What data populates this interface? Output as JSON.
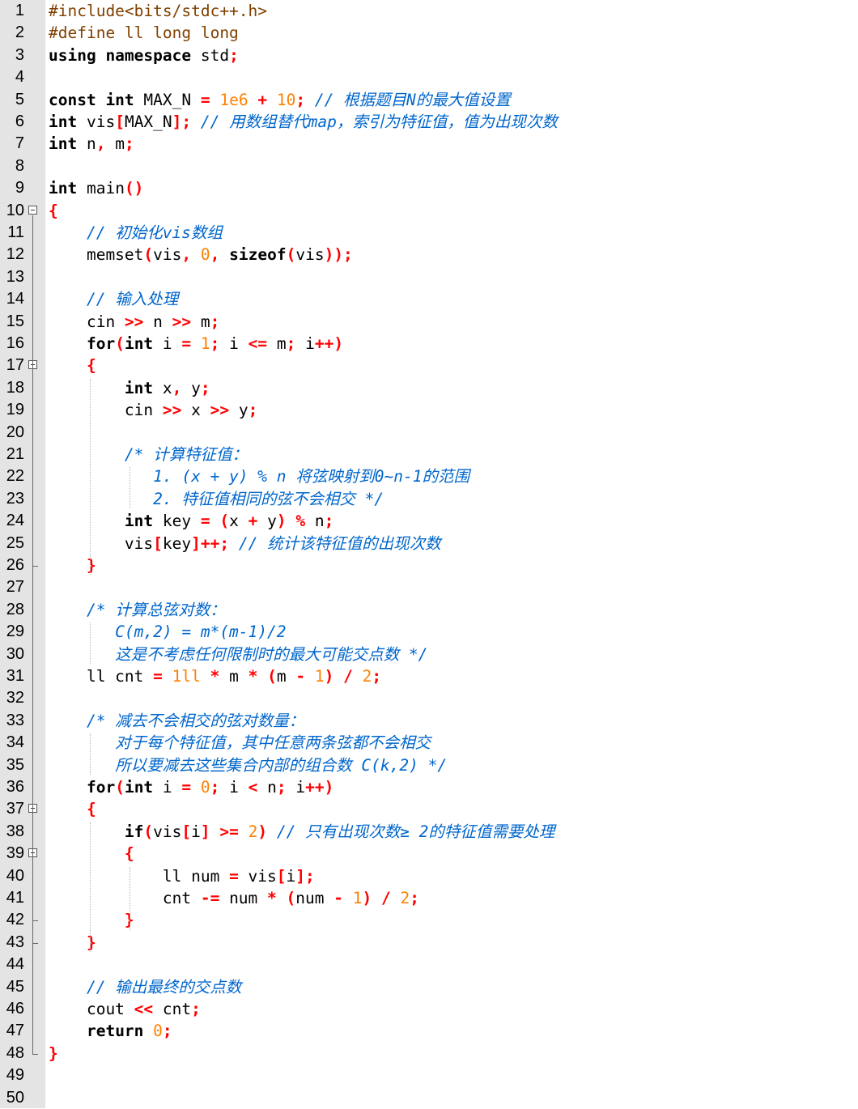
{
  "editor": {
    "language": "C++",
    "colors": {
      "gutter": "#e4e4e4",
      "keyword": "#000000",
      "number": "#ff8000",
      "operator": "#ff0000",
      "preprocessor": "#804000",
      "comment": "#0066cc"
    },
    "lines": [
      {
        "n": "1",
        "tokens": [
          [
            "pp",
            "#include<bits/stdc++.h>"
          ]
        ]
      },
      {
        "n": "2",
        "tokens": [
          [
            "pp",
            "#define ll long long"
          ]
        ]
      },
      {
        "n": "3",
        "tokens": [
          [
            "kw",
            "using namespace"
          ],
          [
            "t",
            " std"
          ],
          [
            "op",
            ";"
          ]
        ]
      },
      {
        "n": "4",
        "tokens": []
      },
      {
        "n": "5",
        "tokens": [
          [
            "kw",
            "const int"
          ],
          [
            "t",
            " MAX_N "
          ],
          [
            "op",
            "="
          ],
          [
            "t",
            " "
          ],
          [
            "num",
            "1e6"
          ],
          [
            "t",
            " "
          ],
          [
            "op",
            "+"
          ],
          [
            "t",
            " "
          ],
          [
            "num",
            "10"
          ],
          [
            "op",
            ";"
          ],
          [
            "t",
            " "
          ],
          [
            "cm",
            "// 根据题目N的最大值设置"
          ]
        ]
      },
      {
        "n": "6",
        "tokens": [
          [
            "kw",
            "int"
          ],
          [
            "t",
            " vis"
          ],
          [
            "op",
            "["
          ],
          [
            "t",
            "MAX_N"
          ],
          [
            "op",
            "];"
          ],
          [
            "t",
            " "
          ],
          [
            "cm",
            "// 用数组替代map，索引为特征值，值为出现次数"
          ]
        ]
      },
      {
        "n": "7",
        "tokens": [
          [
            "kw",
            "int"
          ],
          [
            "t",
            " n"
          ],
          [
            "op",
            ","
          ],
          [
            "t",
            " m"
          ],
          [
            "op",
            ";"
          ]
        ]
      },
      {
        "n": "8",
        "tokens": []
      },
      {
        "n": "9",
        "tokens": [
          [
            "kw",
            "int"
          ],
          [
            "t",
            " main"
          ],
          [
            "op",
            "()"
          ]
        ]
      },
      {
        "n": "10",
        "fold": true,
        "tokens": [
          [
            "op",
            "{"
          ]
        ]
      },
      {
        "n": "11",
        "tokens": [
          [
            "t",
            "    "
          ],
          [
            "cm",
            "// 初始化vis数组"
          ]
        ]
      },
      {
        "n": "12",
        "tokens": [
          [
            "t",
            "    memset"
          ],
          [
            "op",
            "("
          ],
          [
            "t",
            "vis"
          ],
          [
            "op",
            ","
          ],
          [
            "t",
            " "
          ],
          [
            "num",
            "0"
          ],
          [
            "op",
            ","
          ],
          [
            "t",
            " "
          ],
          [
            "kw",
            "sizeof"
          ],
          [
            "op",
            "("
          ],
          [
            "t",
            "vis"
          ],
          [
            "op",
            "));"
          ]
        ]
      },
      {
        "n": "13",
        "tokens": []
      },
      {
        "n": "14",
        "tokens": [
          [
            "t",
            "    "
          ],
          [
            "cm",
            "// 输入处理"
          ]
        ]
      },
      {
        "n": "15",
        "tokens": [
          [
            "t",
            "    cin "
          ],
          [
            "op",
            ">>"
          ],
          [
            "t",
            " n "
          ],
          [
            "op",
            ">>"
          ],
          [
            "t",
            " m"
          ],
          [
            "op",
            ";"
          ]
        ]
      },
      {
        "n": "16",
        "tokens": [
          [
            "t",
            "    "
          ],
          [
            "kw",
            "for"
          ],
          [
            "op",
            "("
          ],
          [
            "kw",
            "int"
          ],
          [
            "t",
            " i "
          ],
          [
            "op",
            "="
          ],
          [
            "t",
            " "
          ],
          [
            "num",
            "1"
          ],
          [
            "op",
            ";"
          ],
          [
            "t",
            " i "
          ],
          [
            "op",
            "<="
          ],
          [
            "t",
            " m"
          ],
          [
            "op",
            ";"
          ],
          [
            "t",
            " i"
          ],
          [
            "op",
            "++)"
          ]
        ]
      },
      {
        "n": "17",
        "fold": true,
        "tokens": [
          [
            "t",
            "    "
          ],
          [
            "op",
            "{"
          ]
        ]
      },
      {
        "n": "18",
        "tokens": [
          [
            "t",
            "        "
          ],
          [
            "kw",
            "int"
          ],
          [
            "t",
            " x"
          ],
          [
            "op",
            ","
          ],
          [
            "t",
            " y"
          ],
          [
            "op",
            ";"
          ]
        ]
      },
      {
        "n": "19",
        "tokens": [
          [
            "t",
            "        cin "
          ],
          [
            "op",
            ">>"
          ],
          [
            "t",
            " x "
          ],
          [
            "op",
            ">>"
          ],
          [
            "t",
            " y"
          ],
          [
            "op",
            ";"
          ]
        ]
      },
      {
        "n": "20",
        "tokens": []
      },
      {
        "n": "21",
        "tokens": [
          [
            "t",
            "        "
          ],
          [
            "cm",
            "/* 计算特征值："
          ]
        ]
      },
      {
        "n": "22",
        "tokens": [
          [
            "cm",
            "           1. (x + y) % n 将弦映射到0~n-1的范围"
          ]
        ]
      },
      {
        "n": "23",
        "tokens": [
          [
            "cm",
            "           2. 特征值相同的弦不会相交 */"
          ]
        ]
      },
      {
        "n": "24",
        "tokens": [
          [
            "t",
            "        "
          ],
          [
            "kw",
            "int"
          ],
          [
            "t",
            " key "
          ],
          [
            "op",
            "="
          ],
          [
            "t",
            " "
          ],
          [
            "op",
            "("
          ],
          [
            "t",
            "x "
          ],
          [
            "op",
            "+"
          ],
          [
            "t",
            " y"
          ],
          [
            "op",
            ")"
          ],
          [
            "t",
            " "
          ],
          [
            "op",
            "%"
          ],
          [
            "t",
            " n"
          ],
          [
            "op",
            ";"
          ]
        ]
      },
      {
        "n": "25",
        "tokens": [
          [
            "t",
            "        vis"
          ],
          [
            "op",
            "["
          ],
          [
            "t",
            "key"
          ],
          [
            "op",
            "]++;"
          ],
          [
            "t",
            " "
          ],
          [
            "cm",
            "// 统计该特征值的出现次数"
          ]
        ]
      },
      {
        "n": "26",
        "foldEnd": true,
        "tokens": [
          [
            "t",
            "    "
          ],
          [
            "op",
            "}"
          ]
        ]
      },
      {
        "n": "27",
        "tokens": []
      },
      {
        "n": "28",
        "tokens": [
          [
            "t",
            "    "
          ],
          [
            "cm",
            "/* 计算总弦对数："
          ]
        ]
      },
      {
        "n": "29",
        "tokens": [
          [
            "cm",
            "       C(m,2) = m*(m-1)/2"
          ]
        ]
      },
      {
        "n": "30",
        "tokens": [
          [
            "cm",
            "       这是不考虑任何限制时的最大可能交点数 */"
          ]
        ]
      },
      {
        "n": "31",
        "tokens": [
          [
            "t",
            "    ll cnt "
          ],
          [
            "op",
            "="
          ],
          [
            "t",
            " "
          ],
          [
            "num",
            "1ll"
          ],
          [
            "t",
            " "
          ],
          [
            "op",
            "*"
          ],
          [
            "t",
            " m "
          ],
          [
            "op",
            "*"
          ],
          [
            "t",
            " "
          ],
          [
            "op",
            "("
          ],
          [
            "t",
            "m "
          ],
          [
            "op",
            "-"
          ],
          [
            "t",
            " "
          ],
          [
            "num",
            "1"
          ],
          [
            "op",
            ")"
          ],
          [
            "t",
            " "
          ],
          [
            "op",
            "/"
          ],
          [
            "t",
            " "
          ],
          [
            "num",
            "2"
          ],
          [
            "op",
            ";"
          ]
        ]
      },
      {
        "n": "32",
        "tokens": []
      },
      {
        "n": "33",
        "tokens": [
          [
            "t",
            "    "
          ],
          [
            "cm",
            "/* 减去不会相交的弦对数量："
          ]
        ]
      },
      {
        "n": "34",
        "tokens": [
          [
            "cm",
            "       对于每个特征值，其中任意两条弦都不会相交"
          ]
        ]
      },
      {
        "n": "35",
        "tokens": [
          [
            "cm",
            "       所以要减去这些集合内部的组合数 C(k,2) */"
          ]
        ]
      },
      {
        "n": "36",
        "tokens": [
          [
            "t",
            "    "
          ],
          [
            "kw",
            "for"
          ],
          [
            "op",
            "("
          ],
          [
            "kw",
            "int"
          ],
          [
            "t",
            " i "
          ],
          [
            "op",
            "="
          ],
          [
            "t",
            " "
          ],
          [
            "num",
            "0"
          ],
          [
            "op",
            ";"
          ],
          [
            "t",
            " i "
          ],
          [
            "op",
            "<"
          ],
          [
            "t",
            " n"
          ],
          [
            "op",
            ";"
          ],
          [
            "t",
            " i"
          ],
          [
            "op",
            "++)"
          ]
        ]
      },
      {
        "n": "37",
        "fold": true,
        "tokens": [
          [
            "t",
            "    "
          ],
          [
            "op",
            "{"
          ]
        ]
      },
      {
        "n": "38",
        "tokens": [
          [
            "t",
            "        "
          ],
          [
            "kw",
            "if"
          ],
          [
            "op",
            "("
          ],
          [
            "t",
            "vis"
          ],
          [
            "op",
            "["
          ],
          [
            "t",
            "i"
          ],
          [
            "op",
            "]"
          ],
          [
            "t",
            " "
          ],
          [
            "op",
            ">="
          ],
          [
            "t",
            " "
          ],
          [
            "num",
            "2"
          ],
          [
            "op",
            ")"
          ],
          [
            "t",
            " "
          ],
          [
            "cm",
            "// 只有出现次数≥ 2的特征值需要处理"
          ]
        ]
      },
      {
        "n": "39",
        "fold": true,
        "tokens": [
          [
            "t",
            "        "
          ],
          [
            "op",
            "{"
          ]
        ]
      },
      {
        "n": "40",
        "tokens": [
          [
            "t",
            "            ll num "
          ],
          [
            "op",
            "="
          ],
          [
            "t",
            " vis"
          ],
          [
            "op",
            "["
          ],
          [
            "t",
            "i"
          ],
          [
            "op",
            "];"
          ]
        ]
      },
      {
        "n": "41",
        "tokens": [
          [
            "t",
            "            cnt "
          ],
          [
            "op",
            "-="
          ],
          [
            "t",
            " num "
          ],
          [
            "op",
            "*"
          ],
          [
            "t",
            " "
          ],
          [
            "op",
            "("
          ],
          [
            "t",
            "num "
          ],
          [
            "op",
            "-"
          ],
          [
            "t",
            " "
          ],
          [
            "num",
            "1"
          ],
          [
            "op",
            ")"
          ],
          [
            "t",
            " "
          ],
          [
            "op",
            "/"
          ],
          [
            "t",
            " "
          ],
          [
            "num",
            "2"
          ],
          [
            "op",
            ";"
          ]
        ]
      },
      {
        "n": "42",
        "foldEnd": true,
        "tokens": [
          [
            "t",
            "        "
          ],
          [
            "op",
            "}"
          ]
        ]
      },
      {
        "n": "43",
        "foldEnd": true,
        "tokens": [
          [
            "t",
            "    "
          ],
          [
            "op",
            "}"
          ]
        ]
      },
      {
        "n": "44",
        "tokens": []
      },
      {
        "n": "45",
        "tokens": [
          [
            "t",
            "    "
          ],
          [
            "cm",
            "// 输出最终的交点数"
          ]
        ]
      },
      {
        "n": "46",
        "tokens": [
          [
            "t",
            "    cout "
          ],
          [
            "op",
            "<<"
          ],
          [
            "t",
            " cnt"
          ],
          [
            "op",
            ";"
          ]
        ]
      },
      {
        "n": "47",
        "tokens": [
          [
            "t",
            "    "
          ],
          [
            "kw",
            "return"
          ],
          [
            "t",
            " "
          ],
          [
            "num",
            "0"
          ],
          [
            "op",
            ";"
          ]
        ]
      },
      {
        "n": "48",
        "foldEnd": true,
        "tokens": [
          [
            "op",
            "}"
          ]
        ]
      },
      {
        "n": "49",
        "tokens": []
      },
      {
        "n": "50",
        "tokens": []
      }
    ]
  }
}
